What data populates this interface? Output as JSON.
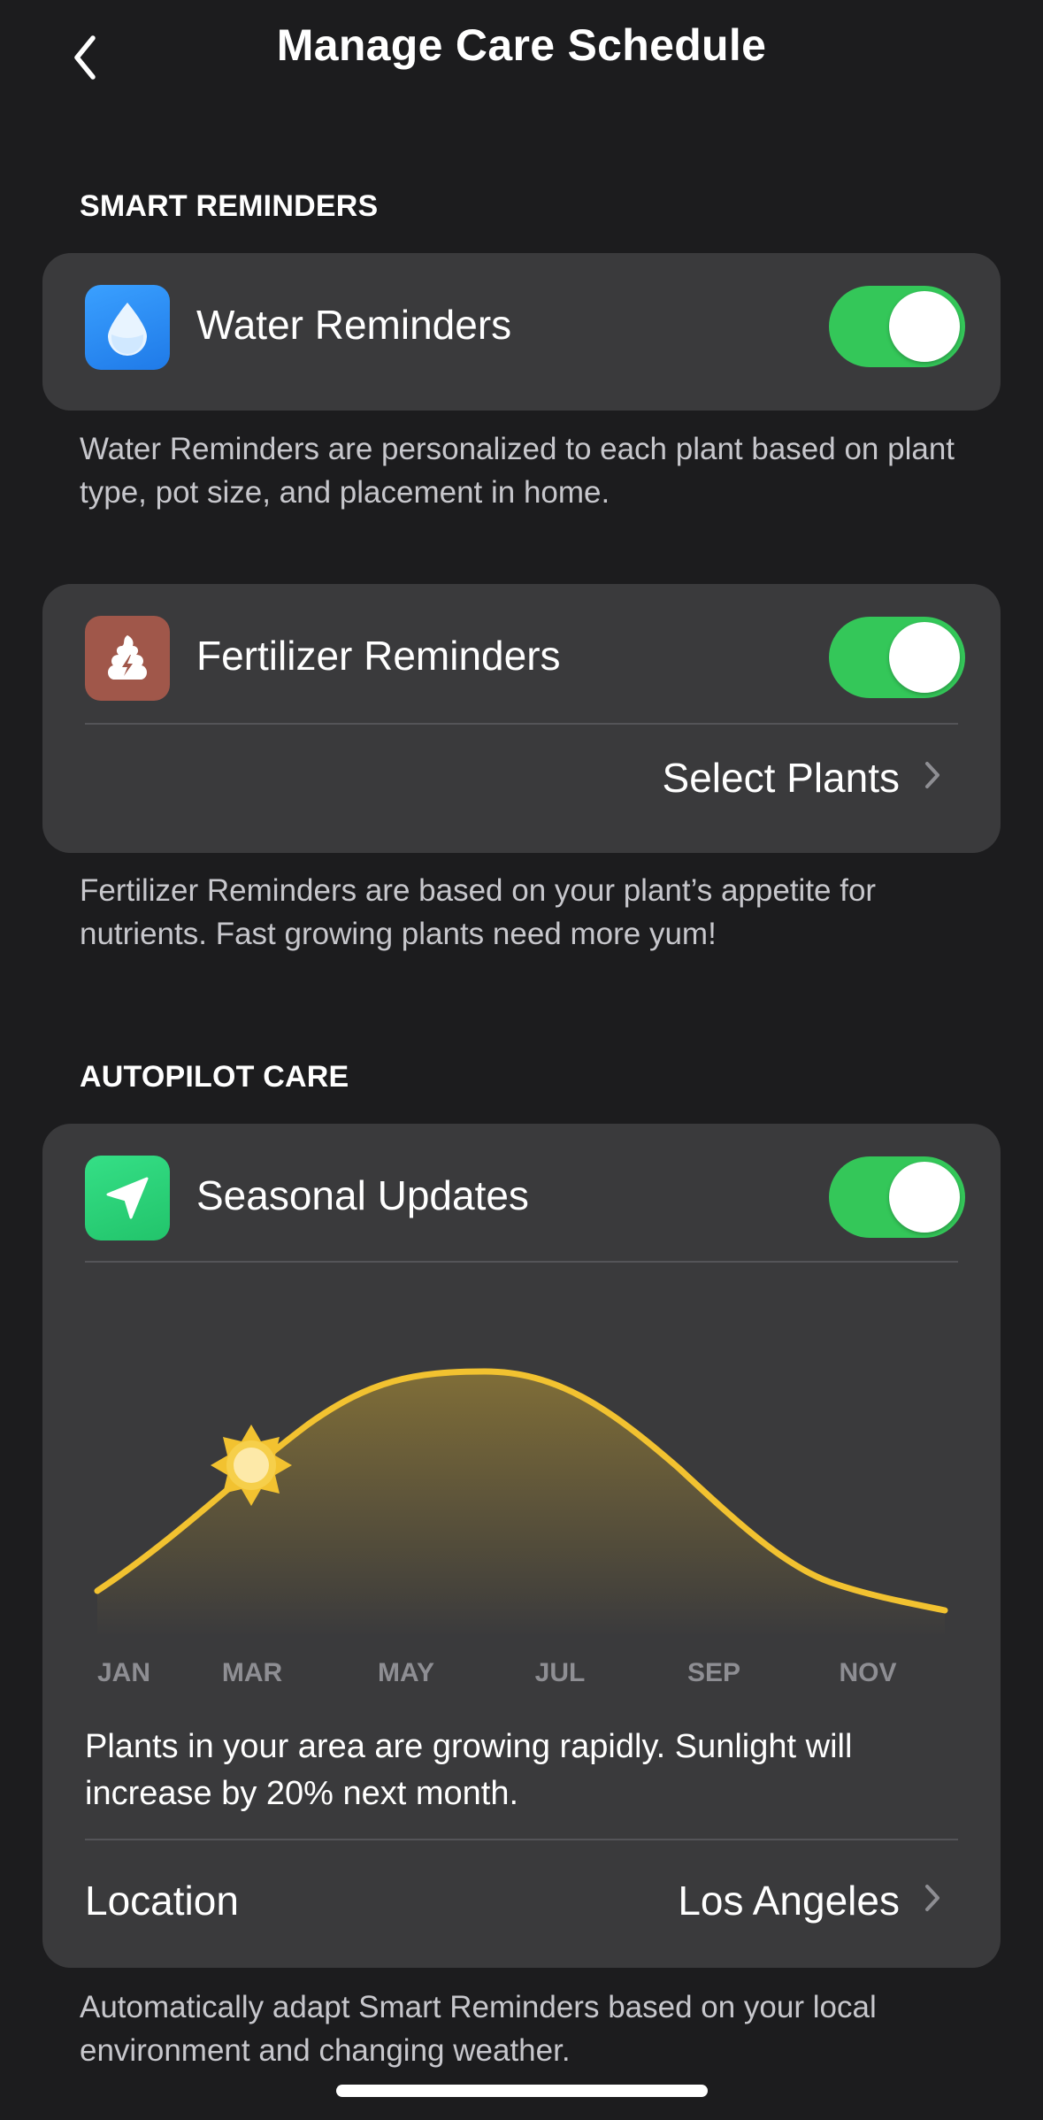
{
  "header": {
    "title": "Manage Care Schedule"
  },
  "sections": {
    "smart_reminders": "SMART REMINDERS",
    "autopilot_care": "AUTOPILOT CARE"
  },
  "water": {
    "label": "Water Reminders",
    "enabled": true,
    "footnote": "Water Reminders are personalized to each plant based on plant type, pot size, and placement in home."
  },
  "fertilizer": {
    "label": "Fertilizer Reminders",
    "enabled": true,
    "select_plants": "Select Plants",
    "footnote": "Fertilizer Reminders are based on your plant’s appetite for nutrients. Fast growing plants need more yum!"
  },
  "seasonal": {
    "label": "Seasonal Updates",
    "enabled": true,
    "months": [
      "JAN",
      "MAR",
      "MAY",
      "JUL",
      "SEP",
      "NOV"
    ],
    "message": "Plants in your area are growing rapidly. Sunlight will increase by 20% next month.",
    "location_label": "Location",
    "location_value": "Los Angeles",
    "footnote": "Automatically adapt Smart Reminders based on your local environment and changing weather."
  },
  "colors": {
    "background": "#1c1c1e",
    "card": "#3a3a3c",
    "toggle_on": "#34c759",
    "water_icon": "#2f8cf5",
    "fertilizer_icon": "#a0574a",
    "seasonal_icon": "#2fd17a",
    "sun_curve": "#f2c230"
  },
  "icons": {
    "back": "chevron-left-icon",
    "water": "water-drop-icon",
    "fertilizer": "fertilizer-icon",
    "seasonal": "location-arrow-icon",
    "sun": "sun-icon",
    "chevron": "chevron-right-icon"
  }
}
